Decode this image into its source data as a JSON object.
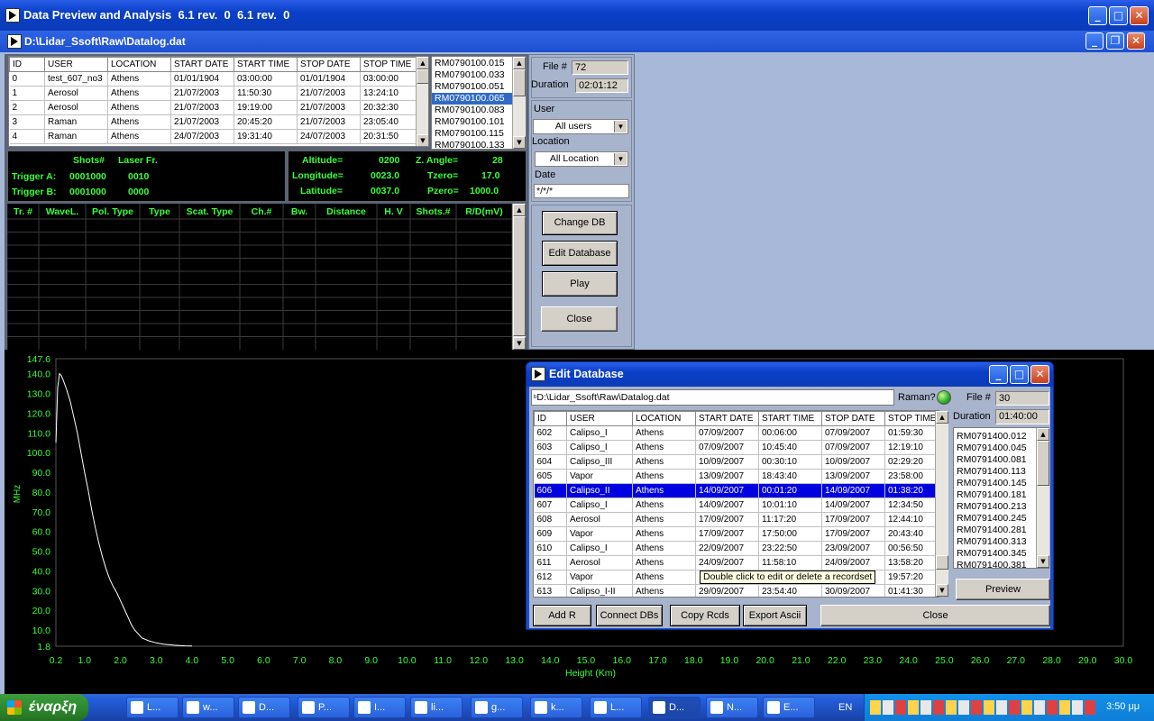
{
  "main_window": {
    "title": "Data Preview and Analysis  6.1 rev.  0  6.1 rev.  0",
    "child_title": "D:\\Lidar_Ssoft\\Raw\\Datalog.dat"
  },
  "records_table": {
    "headers": [
      "ID",
      "USER",
      "LOCATION",
      "START DATE",
      "START TIME",
      "STOP DATE",
      "STOP TIME"
    ],
    "rows": [
      [
        "0",
        "test_607_no3",
        "Athens",
        "01/01/1904",
        "03:00:00",
        "01/01/1904",
        "03:00:00"
      ],
      [
        "1",
        "Aerosol",
        "Athens",
        "21/07/2003",
        "11:50:30",
        "21/07/2003",
        "13:24:10"
      ],
      [
        "2",
        "Aerosol",
        "Athens",
        "21/07/2003",
        "19:19:00",
        "21/07/2003",
        "20:32:30"
      ],
      [
        "3",
        "Raman",
        "Athens",
        "21/07/2003",
        "20:45:20",
        "21/07/2003",
        "23:05:40"
      ],
      [
        "4",
        "Raman",
        "Athens",
        "24/07/2003",
        "19:31:40",
        "24/07/2003",
        "20:31:50"
      ]
    ]
  },
  "file_list": {
    "items": [
      "RM0790100.015",
      "RM0790100.033",
      "RM0790100.051",
      "RM0790100.065",
      "RM0790100.083",
      "RM0790100.101",
      "RM0790100.115",
      "RM0790100.133"
    ],
    "selected_index": 3
  },
  "info_panel": {
    "shots_label": "Shots#",
    "laser_label": "Laser Fr.",
    "trigger_a_label": "Trigger A:",
    "trigger_a_shots": "0001000",
    "trigger_a_laser": "0010",
    "trigger_b_label": "Trigger B:",
    "trigger_b_shots": "0001000",
    "trigger_b_laser": "0000",
    "altitude_label": "Altitude=",
    "altitude": "0200",
    "longitude_label": "Longitude=",
    "longitude": "0023.0",
    "latitude_label": "Latitude=",
    "latitude": "0037.0",
    "zangle_label": "Z. Angle=",
    "zangle": "28",
    "tzero_label": "Tzero=",
    "tzero": "17.0",
    "pzero_label": "Pzero=",
    "pzero": "1000.0"
  },
  "transient_table": {
    "headers": [
      "Tr. #",
      "WaveL.",
      "Pol. Type",
      "Type",
      "Scat. Type",
      "Ch.#",
      "Bw.",
      "Distance",
      "H. V",
      "Shots.#",
      "R/D(mV)"
    ]
  },
  "side_panel": {
    "file_label": "File #",
    "file_value": "72",
    "duration_label": "Duration",
    "duration_value": "02:01:12",
    "user_label": "User",
    "user_value": "All users",
    "location_label": "Location",
    "location_value": "All Location",
    "date_label": "Date",
    "date_value": "*/*/*",
    "change_db": "Change DB",
    "edit_db": "Edit Database",
    "play": "Play",
    "close": "Close"
  },
  "chart_data": {
    "type": "line",
    "xlabel": "Height (Km)",
    "ylabel": "MHz",
    "xlim": [
      0.2,
      30.0
    ],
    "ylim": [
      1.8,
      147.6
    ],
    "x_ticks": [
      "0.2",
      "1.0",
      "2.0",
      "3.0",
      "4.0",
      "5.0",
      "6.0",
      "7.0",
      "8.0",
      "9.0",
      "10.0",
      "11.0",
      "12.0",
      "13.0",
      "14.0",
      "15.0",
      "16.0",
      "17.0",
      "18.0",
      "19.0",
      "20.0",
      "21.0",
      "22.0",
      "23.0",
      "24.0",
      "25.0",
      "26.0",
      "27.0",
      "28.0",
      "29.0",
      "30.0"
    ],
    "y_ticks": [
      "1.8",
      "10.0",
      "20.0",
      "30.0",
      "40.0",
      "50.0",
      "60.0",
      "70.0",
      "80.0",
      "90.0",
      "100.0",
      "110.0",
      "120.0",
      "130.0",
      "140.0",
      "147.6"
    ],
    "series": [
      {
        "x": [
          0.2,
          0.25,
          0.3,
          0.35,
          0.4,
          0.5,
          0.6,
          0.7,
          0.8,
          0.9,
          1.0,
          1.1,
          1.2,
          1.3,
          1.4,
          1.5,
          1.6,
          1.7,
          1.8,
          1.9,
          2.0,
          2.1,
          2.2,
          2.3,
          2.4,
          2.5,
          2.6,
          2.8,
          3.0,
          3.2,
          3.5,
          3.8,
          4.0
        ],
        "y": [
          105,
          133,
          140,
          139,
          137,
          132,
          126,
          118,
          110,
          100,
          90,
          81,
          71,
          62,
          54,
          47,
          41,
          36,
          32,
          29,
          25,
          21,
          17,
          13,
          10,
          8,
          6,
          4.5,
          3.5,
          2.8,
          2.3,
          2.0,
          1.9
        ]
      }
    ],
    "line_color": "#ffffff",
    "axis_color": "#39ff39"
  },
  "edit_db_window": {
    "title": "Edit Database",
    "path": "D:\\Lidar_Ssoft\\Raw\\Datalog.dat",
    "raman_label": "Raman?",
    "file_label": "File #",
    "file_value": "30",
    "duration_label": "Duration",
    "duration_value": "01:40:00",
    "headers": [
      "ID",
      "USER",
      "LOCATION",
      "START DATE",
      "START TIME",
      "STOP DATE",
      "STOP TIME"
    ],
    "rows": [
      [
        "602",
        "Calipso_I",
        "Athens",
        "07/09/2007",
        "00:06:00",
        "07/09/2007",
        "01:59:30"
      ],
      [
        "603",
        "Calipso_I",
        "Athens",
        "07/09/2007",
        "10:45:40",
        "07/09/2007",
        "12:19:10"
      ],
      [
        "604",
        "Calipso_III",
        "Athens",
        "10/09/2007",
        "00:30:10",
        "10/09/2007",
        "02:29:20"
      ],
      [
        "605",
        "Vapor",
        "Athens",
        "13/09/2007",
        "18:43:40",
        "13/09/2007",
        "23:58:00"
      ],
      [
        "606",
        "Calipso_II",
        "Athens",
        "14/09/2007",
        "00:01:20",
        "14/09/2007",
        "01:38:20"
      ],
      [
        "607",
        "Calipso_I",
        "Athens",
        "14/09/2007",
        "10:01:10",
        "14/09/2007",
        "12:34:50"
      ],
      [
        "608",
        "Aerosol",
        "Athens",
        "17/09/2007",
        "11:17:20",
        "17/09/2007",
        "12:44:10"
      ],
      [
        "609",
        "Vapor",
        "Athens",
        "17/09/2007",
        "17:50:00",
        "17/09/2007",
        "20:43:40"
      ],
      [
        "610",
        "Calipso_I",
        "Athens",
        "22/09/2007",
        "23:22:50",
        "23/09/2007",
        "00:56:50"
      ],
      [
        "611",
        "Aerosol",
        "Athens",
        "24/09/2007",
        "11:58:10",
        "24/09/2007",
        "13:58:20"
      ],
      [
        "612",
        "Vapor",
        "Athens",
        "",
        "",
        "",
        "19:57:20"
      ],
      [
        "613",
        "Calipso_I-II",
        "Athens",
        "29/09/2007",
        "23:54:40",
        "30/09/2007",
        "01:41:30"
      ]
    ],
    "selected_row": 4,
    "tooltip": "Double click to edit or delete a recordset",
    "file_list": [
      "RM0791400.012",
      "RM0791400.045",
      "RM0791400.081",
      "RM0791400.113",
      "RM0791400.145",
      "RM0791400.181",
      "RM0791400.213",
      "RM0791400.245",
      "RM0791400.281",
      "RM0791400.313",
      "RM0791400.345",
      "RM0791400.381"
    ],
    "preview": "Preview",
    "add_r": "Add R",
    "connect_dbs": "Connect DBs",
    "copy_rcds": "Copy Rcds",
    "export_ascii": "Export Ascii",
    "close": "Close"
  },
  "taskbar": {
    "start": "έναρξη",
    "items": [
      "L...",
      "w...",
      "D...",
      "P...",
      "I...",
      "li...",
      "g...",
      "k...",
      "L...",
      "D...",
      "N...",
      "E..."
    ],
    "active_index": 9,
    "lang": "EN",
    "clock": "3:50 μμ"
  }
}
